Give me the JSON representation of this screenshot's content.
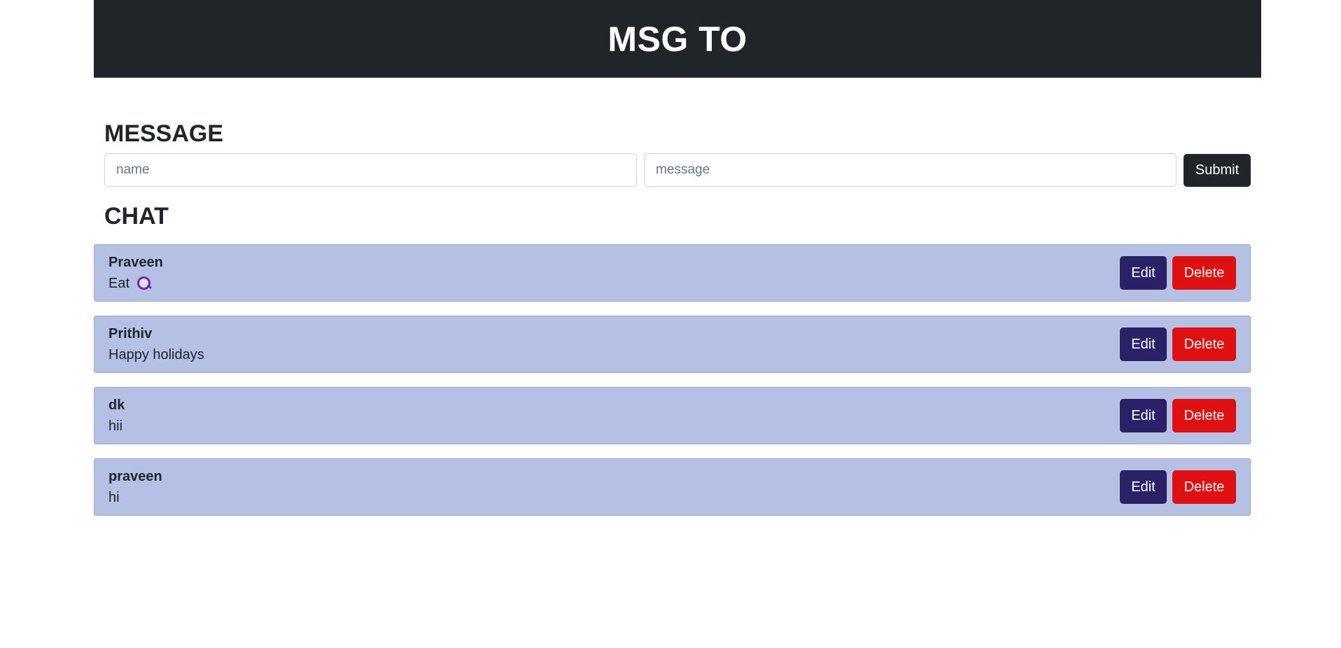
{
  "header": {
    "title": "MSG TO"
  },
  "form": {
    "section_title": "MESSAGE",
    "name_placeholder": "name",
    "message_placeholder": "message",
    "submit_label": "Submit"
  },
  "chat": {
    "section_title": "CHAT",
    "edit_label": "Edit",
    "delete_label": "Delete",
    "items": [
      {
        "name": "Praveen",
        "message": "Eat",
        "icon": "search-emoji-icon"
      },
      {
        "name": "Prithiv",
        "message": "Happy holidays"
      },
      {
        "name": "dk",
        "message": "hii"
      },
      {
        "name": "praveen",
        "message": "hi"
      }
    ]
  },
  "colors": {
    "header_bg": "#212529",
    "chat_item_bg": "#b4c0e4",
    "edit_button": "#2a2167",
    "delete_button": "#e00f10"
  }
}
